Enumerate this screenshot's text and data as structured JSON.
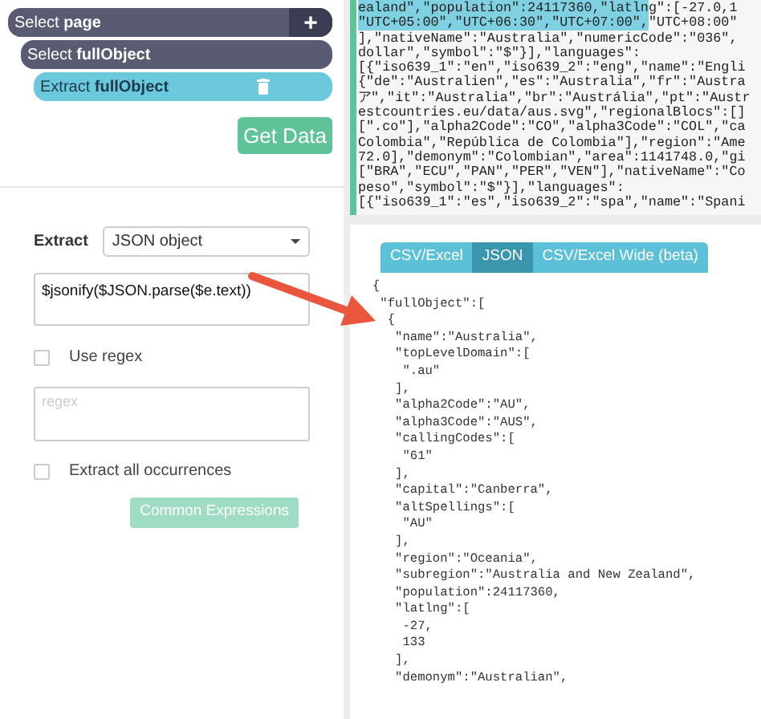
{
  "pipeline": [
    {
      "kind": "select",
      "verb": "Select",
      "target": "page",
      "action": "+"
    },
    {
      "kind": "select",
      "verb": "Select",
      "target": "fullObject"
    },
    {
      "kind": "extract",
      "verb": "Extract",
      "target": "fullObject"
    }
  ],
  "get_data_button": "Get Data",
  "extract_form": {
    "label": "Extract",
    "type_value": "JSON object",
    "expression": "$jsonify($JSON.parse($e.text))",
    "use_regex": {
      "label": "Use regex",
      "checked": false
    },
    "regex_placeholder": "regex",
    "extract_all": {
      "label": "Extract all occurrences",
      "checked": false
    },
    "common_expressions_button": "Common Expressions"
  },
  "raw_lines": [
    {
      "selected": "ealand\",\"population\":24117360,\"latln",
      "text": "g\":[-27.0,1"
    },
    {
      "selected": "\"UTC+05:00\",\"UTC+06:30\",\"UTC+07:00\",",
      "text": "\"UTC+08:00\""
    },
    {
      "text": "],\"nativeName\":\"Australia\",\"numericCode\":\"036\","
    },
    {
      "text": "dollar\",\"symbol\":\"$\"}],\"languages\":"
    },
    {
      "text": "[{\"iso639_1\":\"en\",\"iso639_2\":\"eng\",\"name\":\"Engli"
    },
    {
      "text": "{\"de\":\"Australien\",\"es\":\"Australia\",\"fr\":\"Austra"
    },
    {
      "text": "ア\",\"it\":\"Australia\",\"br\":\"Austrália\",\"pt\":\"Austr"
    },
    {
      "text": "estcountries.eu/data/aus.svg\",\"regionalBlocs\":[]"
    },
    {
      "text": "[\".co\"],\"alpha2Code\":\"CO\",\"alpha3Code\":\"COL\",\"ca"
    },
    {
      "text": "Colombia\",\"República de Colombia\"],\"region\":\"Ame"
    },
    {
      "text": "72.0],\"demonym\":\"Colombian\",\"area\":1141748.0,\"gi"
    },
    {
      "text": "[\"BRA\",\"ECU\",\"PAN\",\"PER\",\"VEN\"],\"nativeName\":\"Co"
    },
    {
      "text": "peso\",\"symbol\":\"$\"}],\"languages\":"
    },
    {
      "text": "[{\"iso639_1\":\"es\",\"iso639_2\":\"spa\",\"name\":\"Spani"
    }
  ],
  "output_tabs": [
    {
      "label": "CSV/Excel",
      "selected": false
    },
    {
      "label": "JSON",
      "selected": true
    },
    {
      "label": "CSV/Excel Wide (beta)",
      "selected": false
    }
  ],
  "json_lines": [
    "{",
    " \"fullObject\":[",
    "  {",
    "   \"name\":\"Australia\",",
    "   \"topLevelDomain\":[",
    "    \".au\"",
    "   ],",
    "   \"alpha2Code\":\"AU\",",
    "   \"alpha3Code\":\"AUS\",",
    "   \"callingCodes\":[",
    "    \"61\"",
    "   ],",
    "   \"capital\":\"Canberra\",",
    "   \"altSpellings\":[",
    "    \"AU\"",
    "   ],",
    "   \"region\":\"Oceania\",",
    "   \"subregion\":\"Australia and New Zealand\",",
    "   \"population\":24117360,",
    "   \"latlng\":[",
    "    -27,",
    "    133",
    "   ],",
    "   \"demonym\":\"Australian\","
  ]
}
